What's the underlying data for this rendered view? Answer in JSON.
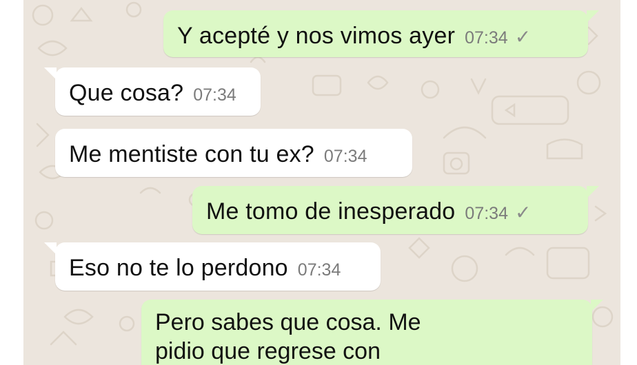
{
  "chat": {
    "messages": [
      {
        "direction": "outgoing",
        "text": "Y acepté y nos vimos ayer",
        "time": "07:34",
        "status_icon": "check-icon",
        "status_glyph": "✓"
      },
      {
        "direction": "incoming",
        "text": "Que cosa?",
        "time": "07:34"
      },
      {
        "direction": "incoming",
        "text": "Me mentiste con tu ex?",
        "time": "07:34"
      },
      {
        "direction": "outgoing",
        "text": "Me tomo de inesperado",
        "time": "07:34",
        "status_icon": "check-icon",
        "status_glyph": "✓"
      },
      {
        "direction": "incoming",
        "text": "Eso no te lo perdono",
        "time": "07:34"
      },
      {
        "direction": "outgoing",
        "lines": [
          "Pero sabes que cosa. Me",
          "pidio que regrese con"
        ]
      }
    ]
  },
  "colors": {
    "background": "#ece5dd",
    "incoming_bubble": "#ffffff",
    "outgoing_bubble": "#dcf8c6",
    "timestamp": "#7b7b7b"
  }
}
